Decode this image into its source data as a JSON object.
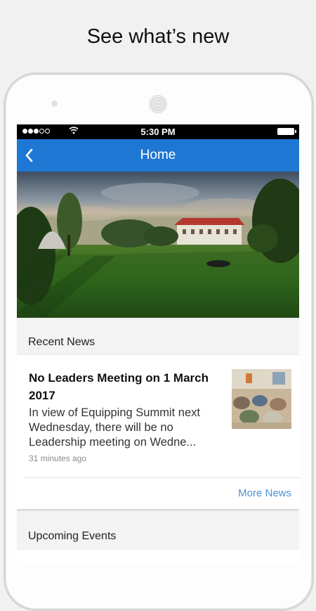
{
  "headline": "See what’s new",
  "status_bar": {
    "time": "5:30 PM",
    "signal_icon": "signal-dots-icon",
    "wifi_icon": "wifi-icon",
    "battery_icon": "battery-icon"
  },
  "navbar": {
    "title": "Home",
    "back_icon": "chevron-left-icon",
    "color": "#1f77d4"
  },
  "recent_news": {
    "section_title": "Recent News",
    "item": {
      "title": "No Leaders Meeting on 1 March 2017",
      "body": "In view of Equipping Summit next  Wednesday, there will be no Leadership meeting on Wedne...",
      "time": "31 minutes ago"
    },
    "more_label": "More News"
  },
  "upcoming_events": {
    "section_title": "Upcoming Events"
  },
  "colors": {
    "link": "#4a90d9",
    "background": "#ececec"
  }
}
